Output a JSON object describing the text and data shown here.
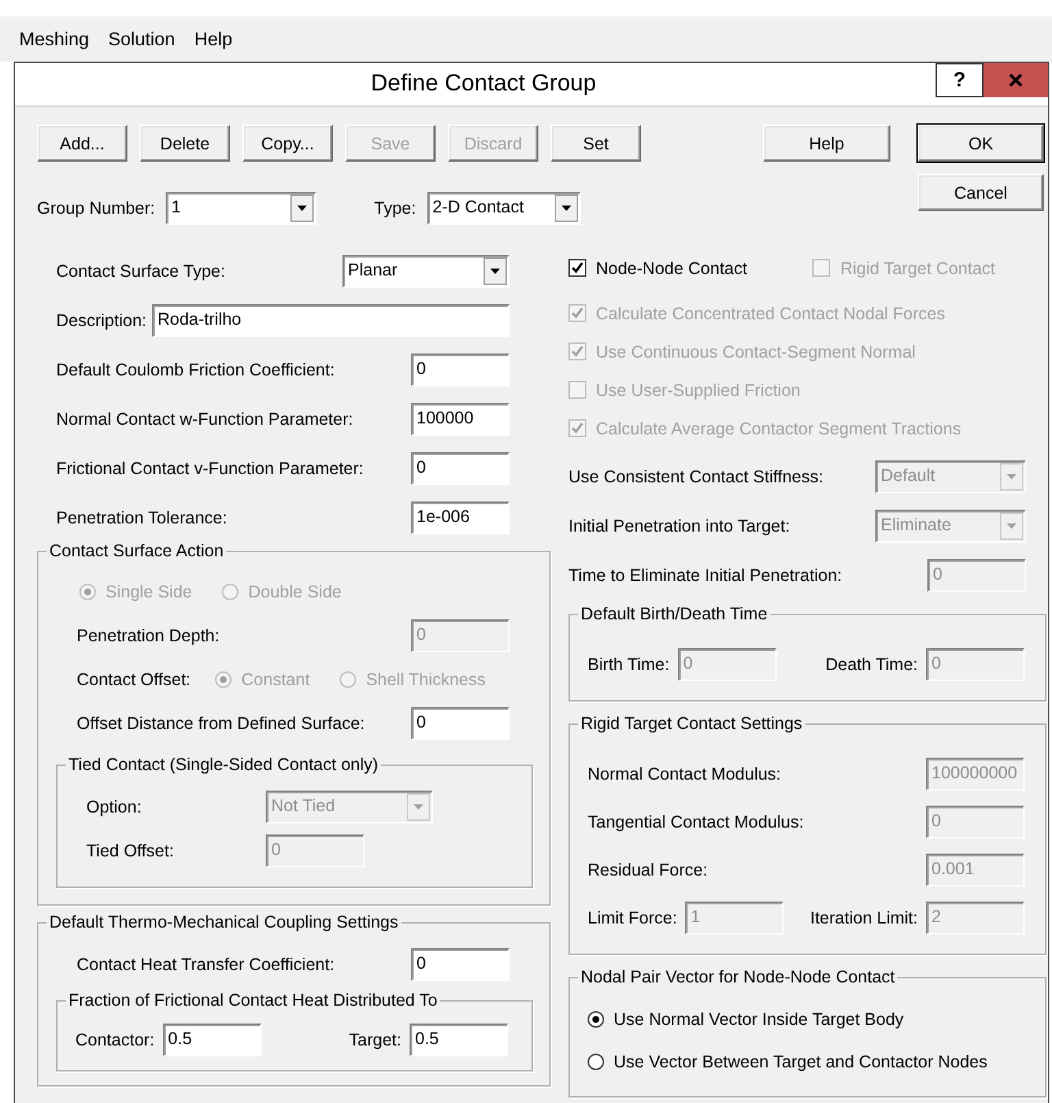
{
  "menu": [
    {
      "label": "Meshing"
    },
    {
      "label": "Solution"
    },
    {
      "label": "Help"
    }
  ],
  "dialog": {
    "title": "Define Contact Group",
    "help_glyph": "?"
  },
  "toolbar": [
    {
      "label": "Add...",
      "disabled": false
    },
    {
      "label": "Delete",
      "disabled": false
    },
    {
      "label": "Copy...",
      "disabled": false
    },
    {
      "label": "Save",
      "disabled": true
    },
    {
      "label": "Discard",
      "disabled": true
    },
    {
      "label": "Set",
      "disabled": false
    }
  ],
  "help_button": {
    "label": "Help"
  },
  "dialog_buttons": [
    {
      "label": "OK",
      "default": true
    },
    {
      "label": "Cancel",
      "default": false
    }
  ],
  "group_number": {
    "label": "Group Number:",
    "value": "1"
  },
  "type": {
    "label": "Type:",
    "value": "2-D Contact"
  },
  "left": [
    {
      "kind": "combo",
      "label": "Contact Surface Type:",
      "value": "Planar",
      "disabled": false
    },
    {
      "kind": "wide-field",
      "label": "Description:",
      "value": "Roda-trilho",
      "disabled": false
    },
    {
      "kind": "field",
      "label": "Default Coulomb Friction Coefficient:",
      "value": "0",
      "disabled": false
    },
    {
      "kind": "field",
      "label": "Normal Contact w-Function Parameter:",
      "value": "100000",
      "disabled": false
    },
    {
      "kind": "field",
      "label": "Frictional Contact v-Function Parameter:",
      "value": "0",
      "disabled": false
    },
    {
      "kind": "field",
      "label": "Penetration Tolerance:",
      "value": "1e-006",
      "disabled": false
    },
    {
      "kind": "group",
      "title": "Contact Surface Action",
      "items": [
        {
          "kind": "radios",
          "options": [
            {
              "label": "Single Side",
              "selected": true,
              "disabled": true
            },
            {
              "label": "Double Side",
              "selected": false,
              "disabled": true
            }
          ]
        },
        {
          "kind": "field",
          "label": "Penetration Depth:",
          "value": "0",
          "disabled": true
        },
        {
          "kind": "radios",
          "label": "Contact Offset:",
          "options": [
            {
              "label": "Constant",
              "selected": true,
              "disabled": true
            },
            {
              "label": "Shell Thickness",
              "selected": false,
              "disabled": true
            }
          ]
        },
        {
          "kind": "field",
          "label": "Offset Distance from Defined Surface:",
          "value": "0",
          "disabled": false
        },
        {
          "kind": "group",
          "title": "Tied Contact (Single-Sided Contact only)",
          "items": [
            {
              "kind": "combo",
              "label": "Option:",
              "value": "Not Tied",
              "disabled": true
            },
            {
              "kind": "field",
              "label": "Tied Offset:",
              "value": "0",
              "disabled": true
            }
          ]
        }
      ]
    },
    {
      "kind": "group",
      "title": "Default Thermo-Mechanical Coupling Settings",
      "items": [
        {
          "kind": "field",
          "label": "Contact Heat Transfer Coefficient:",
          "value": "0",
          "disabled": false
        },
        {
          "kind": "group",
          "title": "Fraction of Frictional Contact Heat Distributed To",
          "items": [
            {
              "kind": "pair",
              "fields": [
                {
                  "label": "Contactor:",
                  "value": "0.5",
                  "disabled": false
                },
                {
                  "label": "Target:",
                  "value": "0.5",
                  "disabled": false
                }
              ]
            }
          ]
        }
      ]
    }
  ],
  "right": [
    {
      "kind": "checks",
      "options": [
        {
          "label": "Node-Node Contact",
          "checked": true,
          "disabled": false
        },
        {
          "label": "Rigid Target Contact",
          "checked": false,
          "disabled": true
        }
      ]
    },
    {
      "kind": "checks",
      "options": [
        {
          "label": "Calculate Concentrated Contact Nodal Forces",
          "checked": true,
          "disabled": true
        }
      ]
    },
    {
      "kind": "checks",
      "options": [
        {
          "label": "Use Continuous Contact-Segment Normal",
          "checked": true,
          "disabled": true
        }
      ]
    },
    {
      "kind": "checks",
      "options": [
        {
          "label": "Use User-Supplied Friction",
          "checked": false,
          "disabled": true
        }
      ]
    },
    {
      "kind": "checks",
      "options": [
        {
          "label": "Calculate Average Contactor Segment Tractions",
          "checked": true,
          "disabled": true
        }
      ]
    },
    {
      "kind": "combo",
      "label": "Use Consistent Contact Stiffness:",
      "value": "Default",
      "disabled": true
    },
    {
      "kind": "combo",
      "label": "Initial Penetration into Target:",
      "value": "Eliminate",
      "disabled": true
    },
    {
      "kind": "field",
      "label": "Time to Eliminate Initial Penetration:",
      "value": "0",
      "disabled": true
    },
    {
      "kind": "group",
      "title": "Default Birth/Death Time",
      "items": [
        {
          "kind": "pair",
          "fields": [
            {
              "label": "Birth Time:",
              "value": "0",
              "disabled": true
            },
            {
              "label": "Death Time:",
              "value": "0",
              "disabled": true
            }
          ]
        }
      ]
    },
    {
      "kind": "group",
      "title": "Rigid Target Contact Settings",
      "items": [
        {
          "kind": "field",
          "label": "Normal Contact Modulus:",
          "value": "100000000",
          "disabled": true
        },
        {
          "kind": "field",
          "label": "Tangential Contact Modulus:",
          "value": "0",
          "disabled": true
        },
        {
          "kind": "field",
          "label": "Residual Force:",
          "value": "0.001",
          "disabled": true
        },
        {
          "kind": "pair",
          "fields": [
            {
              "label": "Limit Force:",
              "value": "1",
              "disabled": true
            },
            {
              "label": "Iteration Limit:",
              "value": "2",
              "disabled": true
            }
          ]
        }
      ]
    },
    {
      "kind": "group",
      "title": "Nodal Pair Vector for Node-Node Contact",
      "items": [
        {
          "kind": "radio-list",
          "options": [
            {
              "label": "Use Normal Vector Inside Target Body",
              "selected": true,
              "disabled": false
            },
            {
              "label": "Use Vector Between Target and Contactor Nodes",
              "selected": false,
              "disabled": false
            }
          ]
        }
      ]
    }
  ]
}
